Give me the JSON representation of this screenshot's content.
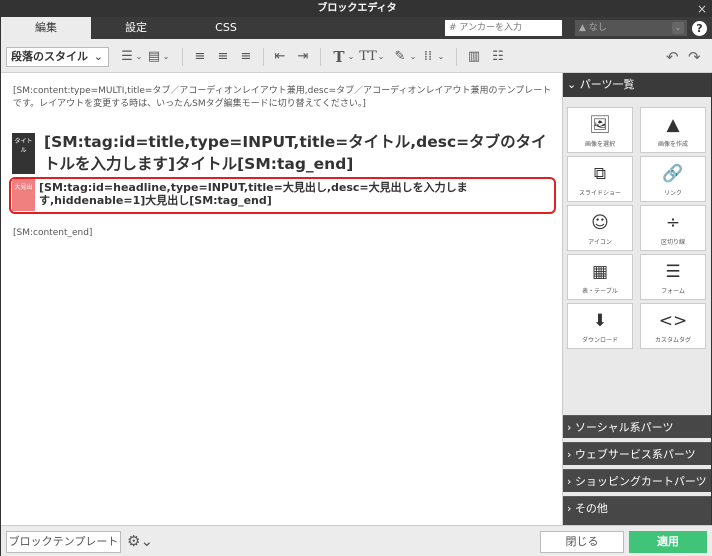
{
  "title": "ブロックエディタ",
  "close_glyph": "×",
  "tabs": [
    {
      "label": "編集",
      "active": true
    },
    {
      "label": "設定",
      "active": false
    },
    {
      "label": "CSS",
      "active": false
    }
  ],
  "anchor": {
    "placeholder": "# アンカーを入力"
  },
  "anchor_select": {
    "label": "▲ なし"
  },
  "help_glyph": "?",
  "toolbar": {
    "paragraph_style": "段落のスタイル",
    "dropdown_glyph": "⌄"
  },
  "editor": {
    "content_start": "[SM:content:type=MULTI,title=タブ／アコーディオンレイアウト兼用,desc=タブ／アコーディオンレイアウト兼用のテンプレートです。レイアウトを変更する時は、いったんSMタグ編集モードに切り替えてください。]",
    "title_badge": "タイトル",
    "title_text": "[SM:tag:id=title,type=INPUT,title=タイトル,desc=タブのタイトルを入力します]タイトル[SM:tag_end]",
    "headline_badge": "大見出",
    "headline_text": "[SM:tag:id=headline,type=INPUT,title=大見出し,desc=大見出しを入力します,hiddenable=1]大見出し[SM:tag_end]",
    "content_end": "[SM:content_end]"
  },
  "panel": {
    "header": "⌄ パーツ一覧",
    "parts": [
      {
        "icon": "🖼",
        "label": "画像を選択"
      },
      {
        "icon": "▲",
        "label": "画像を作成"
      },
      {
        "icon": "⧉",
        "label": "スライドショー"
      },
      {
        "icon": "🔗",
        "label": "リンク"
      },
      {
        "icon": "☺",
        "label": "アイコン"
      },
      {
        "icon": "÷",
        "label": "区切り線"
      },
      {
        "icon": "▦",
        "label": "表・テーブル"
      },
      {
        "icon": "☰",
        "label": "フォーム"
      },
      {
        "icon": "⬇",
        "label": "ダウンロード"
      },
      {
        "icon": "<>",
        "label": "カスタムタグ"
      }
    ],
    "sections": [
      "› ソーシャル系パーツ",
      "› ウェブサービス系パーツ",
      "› ショッピングカートパーツ",
      "› その他"
    ]
  },
  "footer": {
    "template_button": "ブロックテンプレート",
    "gear_glyph": "⚙⌄",
    "close_button": "閉じる",
    "apply_button": "適用"
  }
}
